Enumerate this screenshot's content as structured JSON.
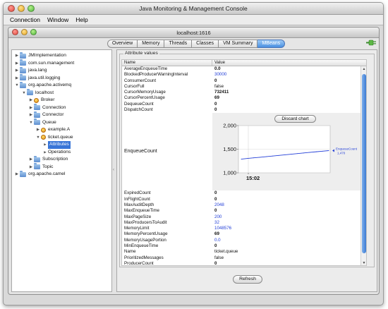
{
  "app_title": "Java Monitoring & Management Console",
  "menu": [
    "Connection",
    "Window",
    "Help"
  ],
  "inner_title": "localhost:1616",
  "tabs": [
    "Overview",
    "Memory",
    "Threads",
    "Classes",
    "VM Summary",
    "MBeans"
  ],
  "active_tab": "MBeans",
  "tree": [
    {
      "label": "JMImplementation",
      "depth": 0,
      "expanded": false,
      "kind": "folder"
    },
    {
      "label": "com.sun.management",
      "depth": 0,
      "expanded": false,
      "kind": "folder"
    },
    {
      "label": "java.lang",
      "depth": 0,
      "expanded": false,
      "kind": "folder"
    },
    {
      "label": "java.util.logging",
      "depth": 0,
      "expanded": false,
      "kind": "folder"
    },
    {
      "label": "org.apache.activemq",
      "depth": 0,
      "expanded": true,
      "kind": "folder"
    },
    {
      "label": "localhost",
      "depth": 1,
      "expanded": true,
      "kind": "folder"
    },
    {
      "label": "Broker",
      "depth": 2,
      "expanded": false,
      "kind": "bean"
    },
    {
      "label": "Connection",
      "depth": 2,
      "expanded": false,
      "kind": "folder"
    },
    {
      "label": "Connector",
      "depth": 2,
      "expanded": false,
      "kind": "folder"
    },
    {
      "label": "Queue",
      "depth": 2,
      "expanded": true,
      "kind": "folder"
    },
    {
      "label": "example.A",
      "depth": 3,
      "expanded": false,
      "kind": "bean"
    },
    {
      "label": "ticket.queue",
      "depth": 3,
      "expanded": true,
      "kind": "bean"
    },
    {
      "label": "Attributes",
      "depth": 4,
      "expanded": false,
      "kind": "leaf",
      "selected": true
    },
    {
      "label": "Operations",
      "depth": 4,
      "expanded": false,
      "kind": "leaf"
    },
    {
      "label": "Subscription",
      "depth": 2,
      "expanded": false,
      "kind": "folder"
    },
    {
      "label": "Topic",
      "depth": 2,
      "expanded": false,
      "kind": "folder"
    },
    {
      "label": "org.apache.camel",
      "depth": 0,
      "expanded": false,
      "kind": "folder"
    }
  ],
  "attributes": {
    "group_label": "Attribute values",
    "col_name": "Name",
    "col_value": "Value",
    "rows_top": [
      {
        "name": "AverageEnqueueTime",
        "value": "0.0",
        "style": "bold"
      },
      {
        "name": "BlockedProducerWarningInterval",
        "value": "30000",
        "style": "blue"
      },
      {
        "name": "ConsumerCount",
        "value": "0",
        "style": "bold"
      },
      {
        "name": "CursorFull",
        "value": "false",
        "style": "plain"
      },
      {
        "name": "CursorMemoryUsage",
        "value": "732411",
        "style": "bold"
      },
      {
        "name": "CursorPercentUsage",
        "value": "69",
        "style": "bold"
      },
      {
        "name": "DequeueCount",
        "value": "0",
        "style": "bold"
      },
      {
        "name": "DispatchCount",
        "value": "0",
        "style": "bold"
      }
    ],
    "chart_row_name": "EnqueueCount",
    "discard_label": "Discard chart",
    "rows_bottom": [
      {
        "name": "ExpiredCount",
        "value": "0",
        "style": "bold"
      },
      {
        "name": "InFlightCount",
        "value": "0",
        "style": "bold"
      },
      {
        "name": "MaxAuditDepth",
        "value": "2048",
        "style": "blue"
      },
      {
        "name": "MaxEnqueueTime",
        "value": "0",
        "style": "bold"
      },
      {
        "name": "MaxPageSize",
        "value": "200",
        "style": "blue"
      },
      {
        "name": "MaxProducersToAudit",
        "value": "32",
        "style": "blue"
      },
      {
        "name": "MemoryLimit",
        "value": "1048576",
        "style": "blue"
      },
      {
        "name": "MemoryPercentUsage",
        "value": "69",
        "style": "bold"
      },
      {
        "name": "MemoryUsagePortion",
        "value": "0.0",
        "style": "blue"
      },
      {
        "name": "MinEnqueueTime",
        "value": "0",
        "style": "bold"
      },
      {
        "name": "Name",
        "value": "ticket.queue",
        "style": "plain"
      },
      {
        "name": "PrioritizedMessages",
        "value": "false",
        "style": "plain"
      },
      {
        "name": "ProducerCount",
        "value": "0",
        "style": "bold"
      }
    ]
  },
  "refresh_label": "Refresh",
  "colors": {
    "accent": "#3875d7",
    "line": "#2440d8"
  },
  "chart_data": {
    "type": "line",
    "series": [
      {
        "name": "EnqueueCount",
        "values": [
          1290,
          1305,
          1318,
          1330,
          1343,
          1356,
          1368,
          1382,
          1395,
          1408,
          1420,
          1433,
          1446,
          1458,
          1470
        ]
      }
    ],
    "yticks": [
      "2,000",
      "1,500",
      "1,000"
    ],
    "ylim": [
      1000,
      2000
    ],
    "xtick": "15:02",
    "legend_label": "EnqueueCount",
    "legend_value": "1,470",
    "grid": true
  }
}
